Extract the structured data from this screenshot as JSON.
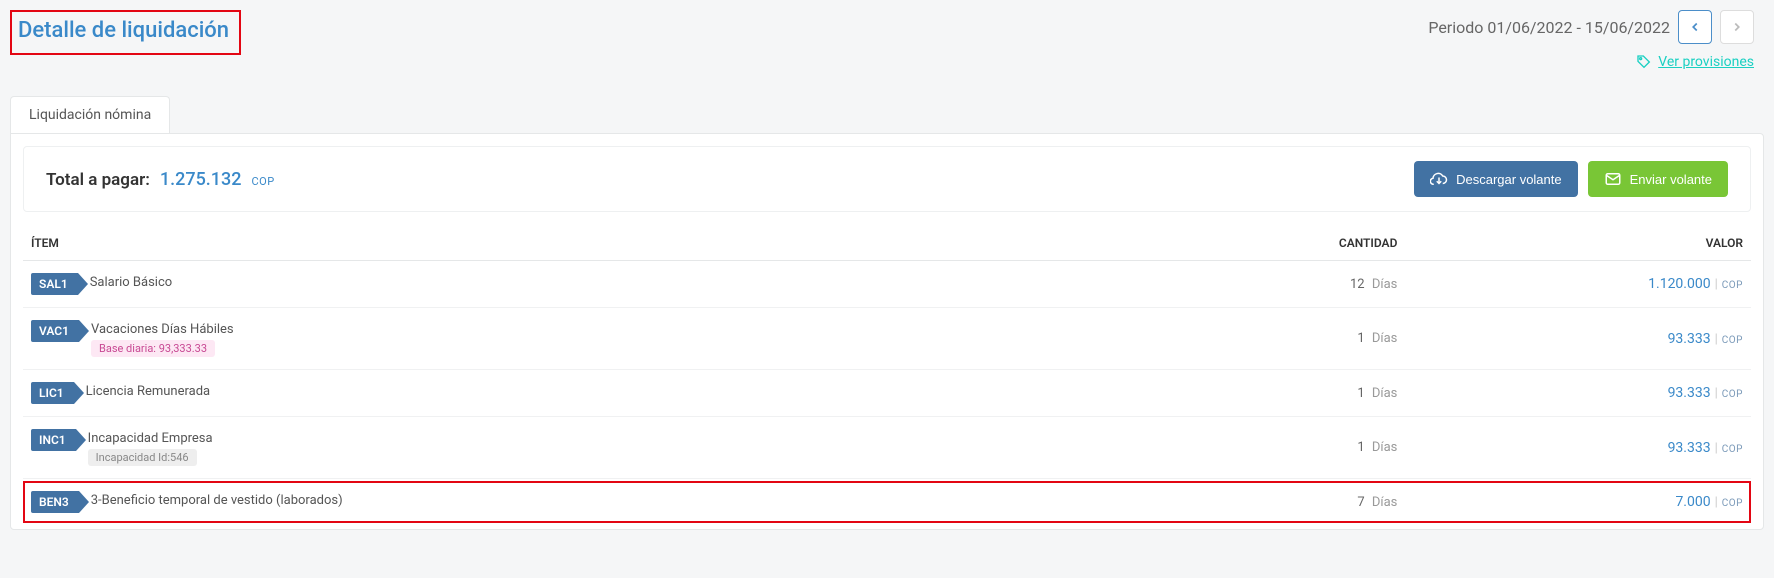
{
  "title": "Detalle de liquidación",
  "period_label": "Periodo 01/06/2022 - 15/06/2022",
  "view_provisions": "Ver provisiones",
  "tab_label": "Liquidación nómina",
  "total": {
    "label": "Total a pagar:",
    "amount": "1.275.132",
    "currency": "COP"
  },
  "buttons": {
    "download": "Descargar volante",
    "send": "Enviar volante"
  },
  "columns": {
    "item": "ÍTEM",
    "qty": "CANTIDAD",
    "value": "VALOR"
  },
  "rows": [
    {
      "code": "SAL1",
      "name": "Salario Básico",
      "qty": "12",
      "unit": "Días",
      "value": "1.120.000",
      "currency": "COP"
    },
    {
      "code": "VAC1",
      "name": "Vacaciones Días Hábiles",
      "sub_pink": "Base diaria: 93,333.33",
      "qty": "1",
      "unit": "Días",
      "value": "93.333",
      "currency": "COP"
    },
    {
      "code": "LIC1",
      "name": "Licencia Remunerada",
      "qty": "1",
      "unit": "Días",
      "value": "93.333",
      "currency": "COP"
    },
    {
      "code": "INC1",
      "name": "Incapacidad Empresa",
      "sub_gray": "Incapacidad Id:546",
      "qty": "1",
      "unit": "Días",
      "value": "93.333",
      "currency": "COP"
    },
    {
      "code": "BEN3",
      "name": "3-Beneficio temporal de vestido (laborados)",
      "qty": "7",
      "unit": "Días",
      "value": "7.000",
      "currency": "COP",
      "highlight": true
    }
  ]
}
